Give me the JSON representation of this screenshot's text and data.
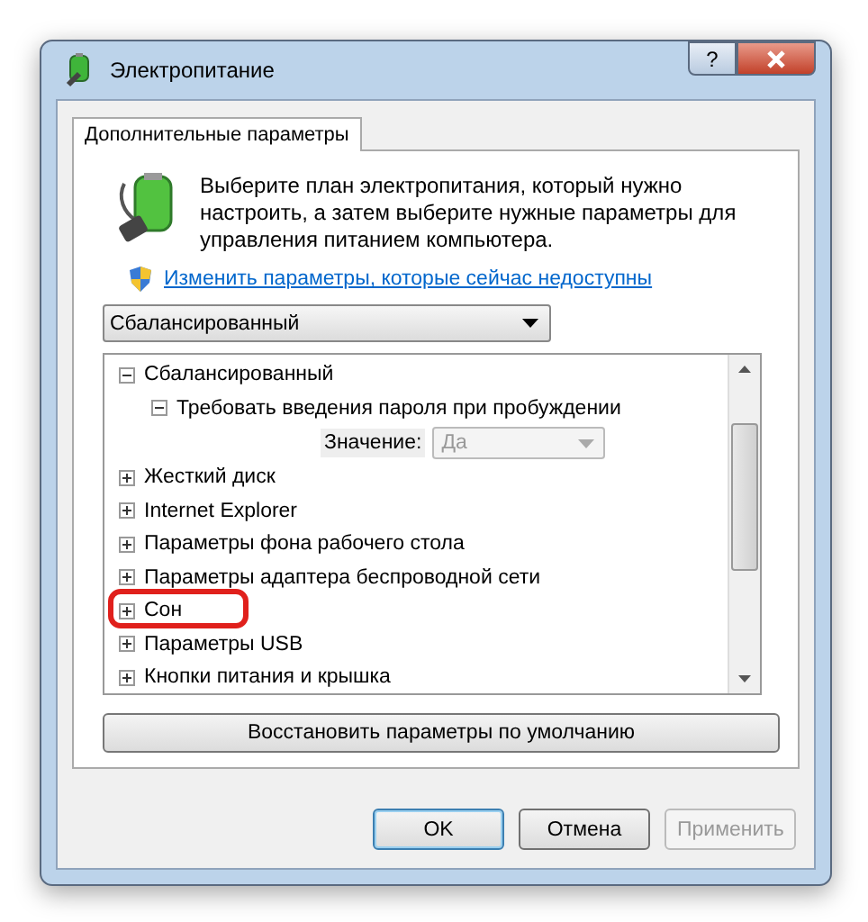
{
  "window": {
    "title": "Электропитание",
    "help_button": "?"
  },
  "tabs": [
    {
      "label": "Дополнительные параметры",
      "selected": true
    }
  ],
  "description": "Выберите план электропитания, который нужно настроить, а затем выберите нужные параметры для управления питанием компьютера.",
  "admin_link": "Изменить параметры, которые сейчас недоступны",
  "plan_select": {
    "value": "Сбалансированный"
  },
  "tree": [
    {
      "label": "Сбалансированный",
      "expanded": true,
      "highlighted": false,
      "children": [
        {
          "label": "Требовать введения пароля при пробуждении",
          "expanded": true,
          "highlighted": false,
          "setting": {
            "label": "Значение:",
            "value": "Да",
            "disabled": true
          }
        }
      ]
    },
    {
      "label": "Жесткий диск",
      "expanded": false,
      "highlighted": false
    },
    {
      "label": "Internet Explorer",
      "expanded": false,
      "highlighted": false
    },
    {
      "label": "Параметры фона рабочего стола",
      "expanded": false,
      "highlighted": false
    },
    {
      "label": "Параметры адаптера беспроводной сети",
      "expanded": false,
      "highlighted": false
    },
    {
      "label": "Сон",
      "expanded": false,
      "highlighted": true
    },
    {
      "label": "Параметры USB",
      "expanded": false,
      "highlighted": false
    },
    {
      "label": "Кнопки питания и крышка",
      "expanded": false,
      "highlighted": false
    }
  ],
  "restore_button": "Восстановить параметры по умолчанию",
  "buttons": [
    {
      "label": "OK",
      "kind": "default",
      "disabled": false
    },
    {
      "label": "Отмена",
      "kind": "normal",
      "disabled": false
    },
    {
      "label": "Применить",
      "kind": "normal",
      "disabled": true
    }
  ]
}
